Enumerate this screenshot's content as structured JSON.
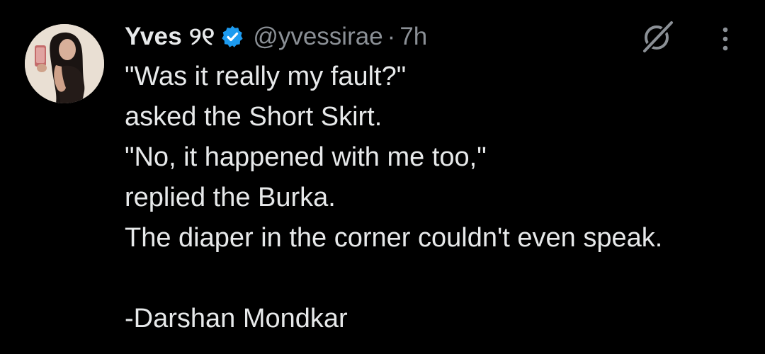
{
  "author": {
    "display_name": "Yves ୨୧",
    "handle": "@yvessirae",
    "separator": "·",
    "time": "7h",
    "verified_icon": "verified-badge-icon",
    "avatar_icon": "profile-avatar"
  },
  "icons": {
    "grok": "grok-icon",
    "more": "more-options-icon"
  },
  "colors": {
    "background": "#000000",
    "text": "#e7e9ea",
    "secondary_text": "#8b9096",
    "verified_blue": "#1d9bf0"
  },
  "tweet": {
    "lines": [
      "\"Was it really my fault?\"",
      "asked the Short Skirt.",
      "\"No, it happened with me too,\"",
      "replied the Burka.",
      "The diaper in the corner couldn't even speak.",
      "",
      "-Darshan Mondkar"
    ]
  }
}
